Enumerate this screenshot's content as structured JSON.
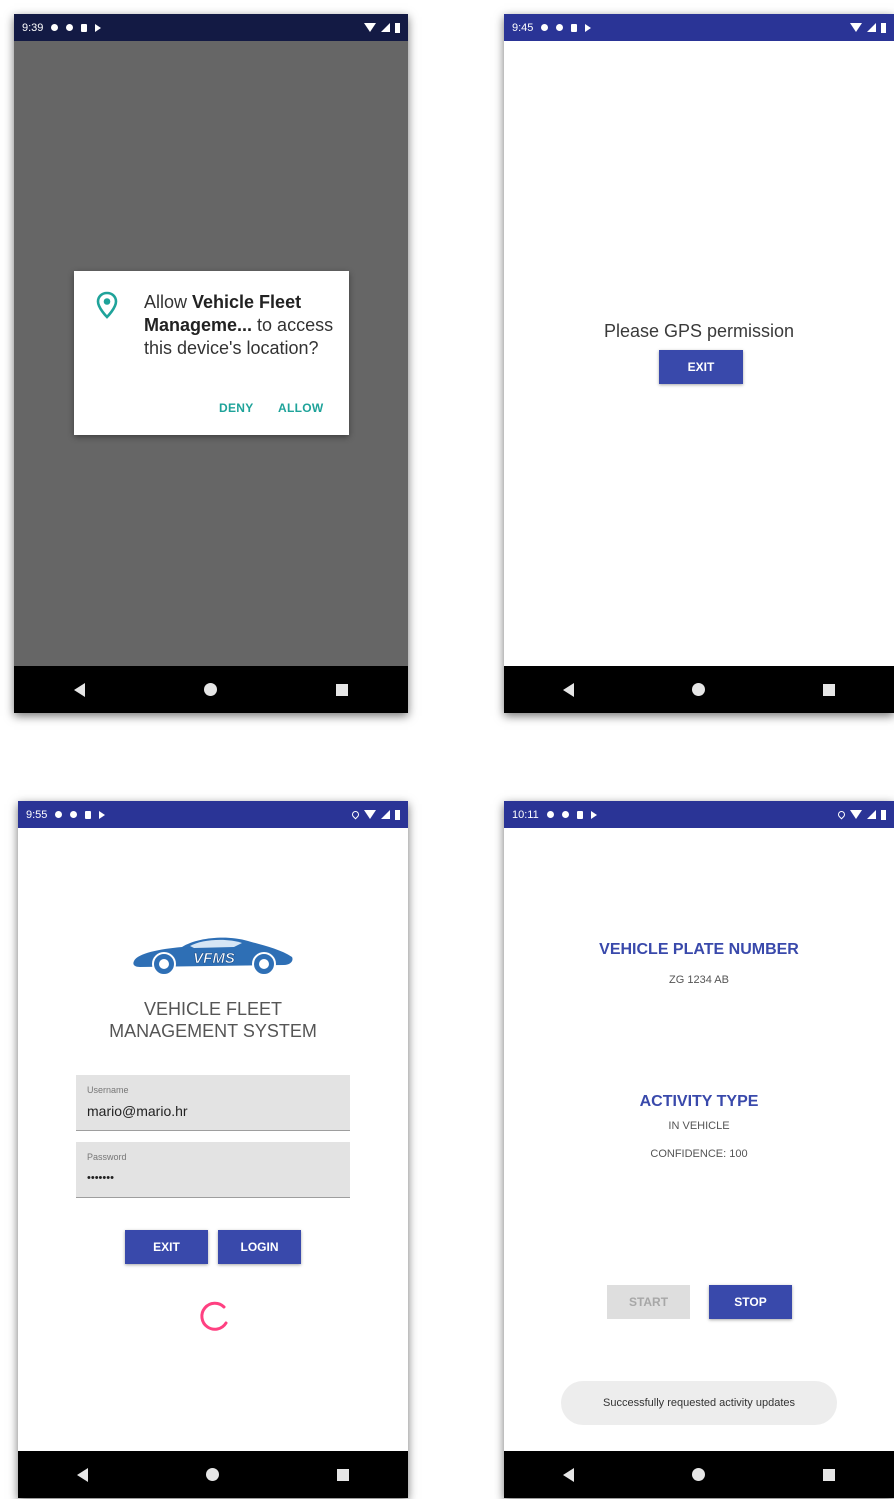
{
  "screen1": {
    "time": "9:39",
    "dialog": {
      "prefix": "Allow ",
      "app_name": "Vehicle Fleet Manageme...",
      "suffix": " to access this device's location?",
      "deny": "DENY",
      "allow": "ALLOW"
    }
  },
  "screen2": {
    "time": "9:45",
    "message": "Please GPS permission",
    "exit": "EXIT"
  },
  "screen3": {
    "time": "9:55",
    "logo_text": "VFMS",
    "title_line1": "VEHICLE FLEET",
    "title_line2": "MANAGEMENT SYSTEM",
    "username_label": "Username",
    "username_value": "mario@mario.hr",
    "password_label": "Password",
    "password_value": "•••••••",
    "exit": "EXIT",
    "login": "LOGIN"
  },
  "screen4": {
    "time": "10:11",
    "plate_heading": "VEHICLE PLATE NUMBER",
    "plate_value": "ZG 1234 AB",
    "activity_heading": "ACTIVITY TYPE",
    "activity_value": "IN VEHICLE",
    "confidence": "CONFIDENCE: 100",
    "start": "START",
    "stop": "STOP",
    "toast": "Successfully requested activity updates"
  },
  "colors": {
    "status_bar": "#2a3496",
    "primary": "#3949ab",
    "dialog_accent": "#1fa39a",
    "spinner": "#ff4081"
  }
}
